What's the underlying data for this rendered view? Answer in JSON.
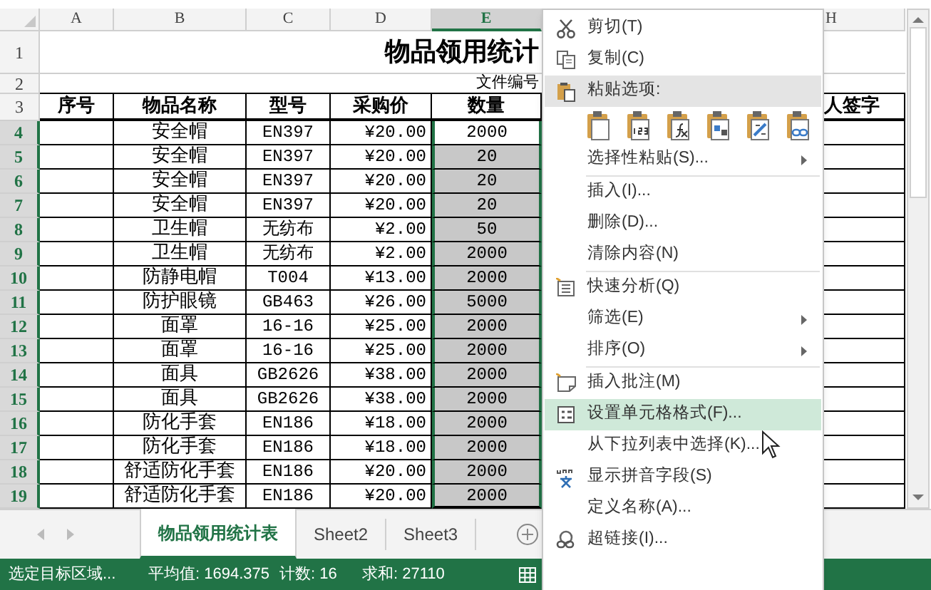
{
  "columns": [
    {
      "label": "A",
      "selected": false
    },
    {
      "label": "B",
      "selected": false
    },
    {
      "label": "C",
      "selected": false
    },
    {
      "label": "D",
      "selected": false
    },
    {
      "label": "E",
      "selected": true
    },
    {
      "label": "H",
      "selected": false
    }
  ],
  "title_row": {
    "num": "1",
    "text": "物品领用统计"
  },
  "info_row": {
    "num": "2",
    "text": "文件编号"
  },
  "header_row": {
    "num": "3",
    "cells": [
      "序号",
      "物品名称",
      "型号",
      "采购价",
      "数量",
      "人签字"
    ]
  },
  "rows": [
    {
      "num": "4",
      "name": "安全帽",
      "model": "EN397",
      "price": "¥20.00",
      "qty": "2000",
      "selected": true,
      "active": true
    },
    {
      "num": "5",
      "name": "安全帽",
      "model": "EN397",
      "price": "¥20.00",
      "qty": "20",
      "selected": true,
      "active": false
    },
    {
      "num": "6",
      "name": "安全帽",
      "model": "EN397",
      "price": "¥20.00",
      "qty": "20",
      "selected": true,
      "active": false
    },
    {
      "num": "7",
      "name": "安全帽",
      "model": "EN397",
      "price": "¥20.00",
      "qty": "20",
      "selected": true,
      "active": false
    },
    {
      "num": "8",
      "name": "卫生帽",
      "model": "无纺布",
      "price": "¥2.00",
      "qty": "50",
      "selected": true,
      "active": false
    },
    {
      "num": "9",
      "name": "卫生帽",
      "model": "无纺布",
      "price": "¥2.00",
      "qty": "2000",
      "selected": true,
      "active": false
    },
    {
      "num": "10",
      "name": "防静电帽",
      "model": "T004",
      "price": "¥13.00",
      "qty": "2000",
      "selected": true,
      "active": false
    },
    {
      "num": "11",
      "name": "防护眼镜",
      "model": "GB463",
      "price": "¥26.00",
      "qty": "5000",
      "selected": true,
      "active": false
    },
    {
      "num": "12",
      "name": "面罩",
      "model": "16-16",
      "price": "¥25.00",
      "qty": "2000",
      "selected": true,
      "active": false
    },
    {
      "num": "13",
      "name": "面罩",
      "model": "16-16",
      "price": "¥25.00",
      "qty": "2000",
      "selected": true,
      "active": false
    },
    {
      "num": "14",
      "name": "面具",
      "model": "GB2626",
      "price": "¥38.00",
      "qty": "2000",
      "selected": true,
      "active": false
    },
    {
      "num": "15",
      "name": "面具",
      "model": "GB2626",
      "price": "¥38.00",
      "qty": "2000",
      "selected": true,
      "active": false
    },
    {
      "num": "16",
      "name": "防化手套",
      "model": "EN186",
      "price": "¥18.00",
      "qty": "2000",
      "selected": true,
      "active": false
    },
    {
      "num": "17",
      "name": "防化手套",
      "model": "EN186",
      "price": "¥18.00",
      "qty": "2000",
      "selected": true,
      "active": false
    },
    {
      "num": "18",
      "name": "舒适防化手套",
      "model": "EN186",
      "price": "¥20.00",
      "qty": "2000",
      "selected": true,
      "active": false
    },
    {
      "num": "19",
      "name": "舒适防化手套",
      "model": "EN186",
      "price": "¥20.00",
      "qty": "2000",
      "selected": true,
      "active": false
    }
  ],
  "sheet_tabs": [
    {
      "label": "物品领用统计表",
      "selected": true
    },
    {
      "label": "Sheet2",
      "selected": false
    },
    {
      "label": "Sheet3",
      "selected": false
    }
  ],
  "status_bar": {
    "mode": "选定目标区域...",
    "average": "平均值: 1694.375",
    "count": "计数: 16",
    "sum": "求和: 27110"
  },
  "context_menu": [
    {
      "kind": "item",
      "label": "剪切(T)",
      "highlighted": false,
      "submenu": false
    },
    {
      "kind": "item",
      "label": "复制(C)",
      "highlighted": false,
      "submenu": false
    },
    {
      "kind": "heading",
      "label": "粘贴选项:"
    },
    {
      "kind": "paste_icons"
    },
    {
      "kind": "item",
      "label": "选择性粘贴(S)...",
      "highlighted": false,
      "submenu": true
    },
    {
      "kind": "separator"
    },
    {
      "kind": "item",
      "label": "插入(I)...",
      "highlighted": false,
      "submenu": false
    },
    {
      "kind": "item",
      "label": "删除(D)...",
      "highlighted": false,
      "submenu": false
    },
    {
      "kind": "item",
      "label": "清除内容(N)",
      "highlighted": false,
      "submenu": false
    },
    {
      "kind": "separator"
    },
    {
      "kind": "item",
      "label": "快速分析(Q)",
      "highlighted": false,
      "submenu": false
    },
    {
      "kind": "item",
      "label": "筛选(E)",
      "highlighted": false,
      "submenu": true
    },
    {
      "kind": "item",
      "label": "排序(O)",
      "highlighted": false,
      "submenu": true
    },
    {
      "kind": "separator"
    },
    {
      "kind": "item",
      "label": "插入批注(M)",
      "highlighted": false,
      "submenu": false
    },
    {
      "kind": "item",
      "label": "设置单元格格式(F)...",
      "highlighted": true,
      "submenu": false
    },
    {
      "kind": "item",
      "label": "从下拉列表中选择(K)...",
      "highlighted": false,
      "submenu": false
    },
    {
      "kind": "item",
      "label": "显示拼音字段(S)",
      "highlighted": false,
      "submenu": false
    },
    {
      "kind": "item",
      "label": "定义名称(A)...",
      "highlighted": false,
      "submenu": false
    },
    {
      "kind": "item",
      "label": "超链接(I)...",
      "highlighted": false,
      "submenu": false
    }
  ]
}
